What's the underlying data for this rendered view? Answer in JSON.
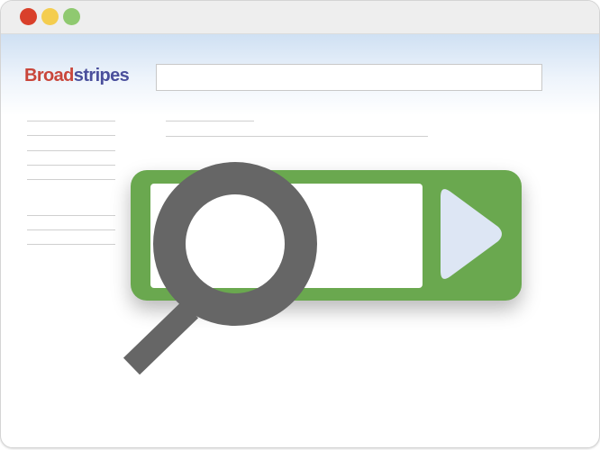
{
  "window": {
    "controls": [
      "close",
      "minimize",
      "maximize"
    ]
  },
  "logo": {
    "part_a": "Broad",
    "part_b": "stripes"
  },
  "address_bar": {
    "value": ""
  },
  "search_box": {
    "value": ""
  },
  "icons": {
    "magnifier": "magnifier-icon",
    "go": "play-triangle-icon"
  },
  "colors": {
    "accent_green": "#6aa84f",
    "logo_red": "#c9463b",
    "logo_blue": "#4a4f9c",
    "icon_gray": "#666666",
    "button_tint": "#dde6f4"
  }
}
